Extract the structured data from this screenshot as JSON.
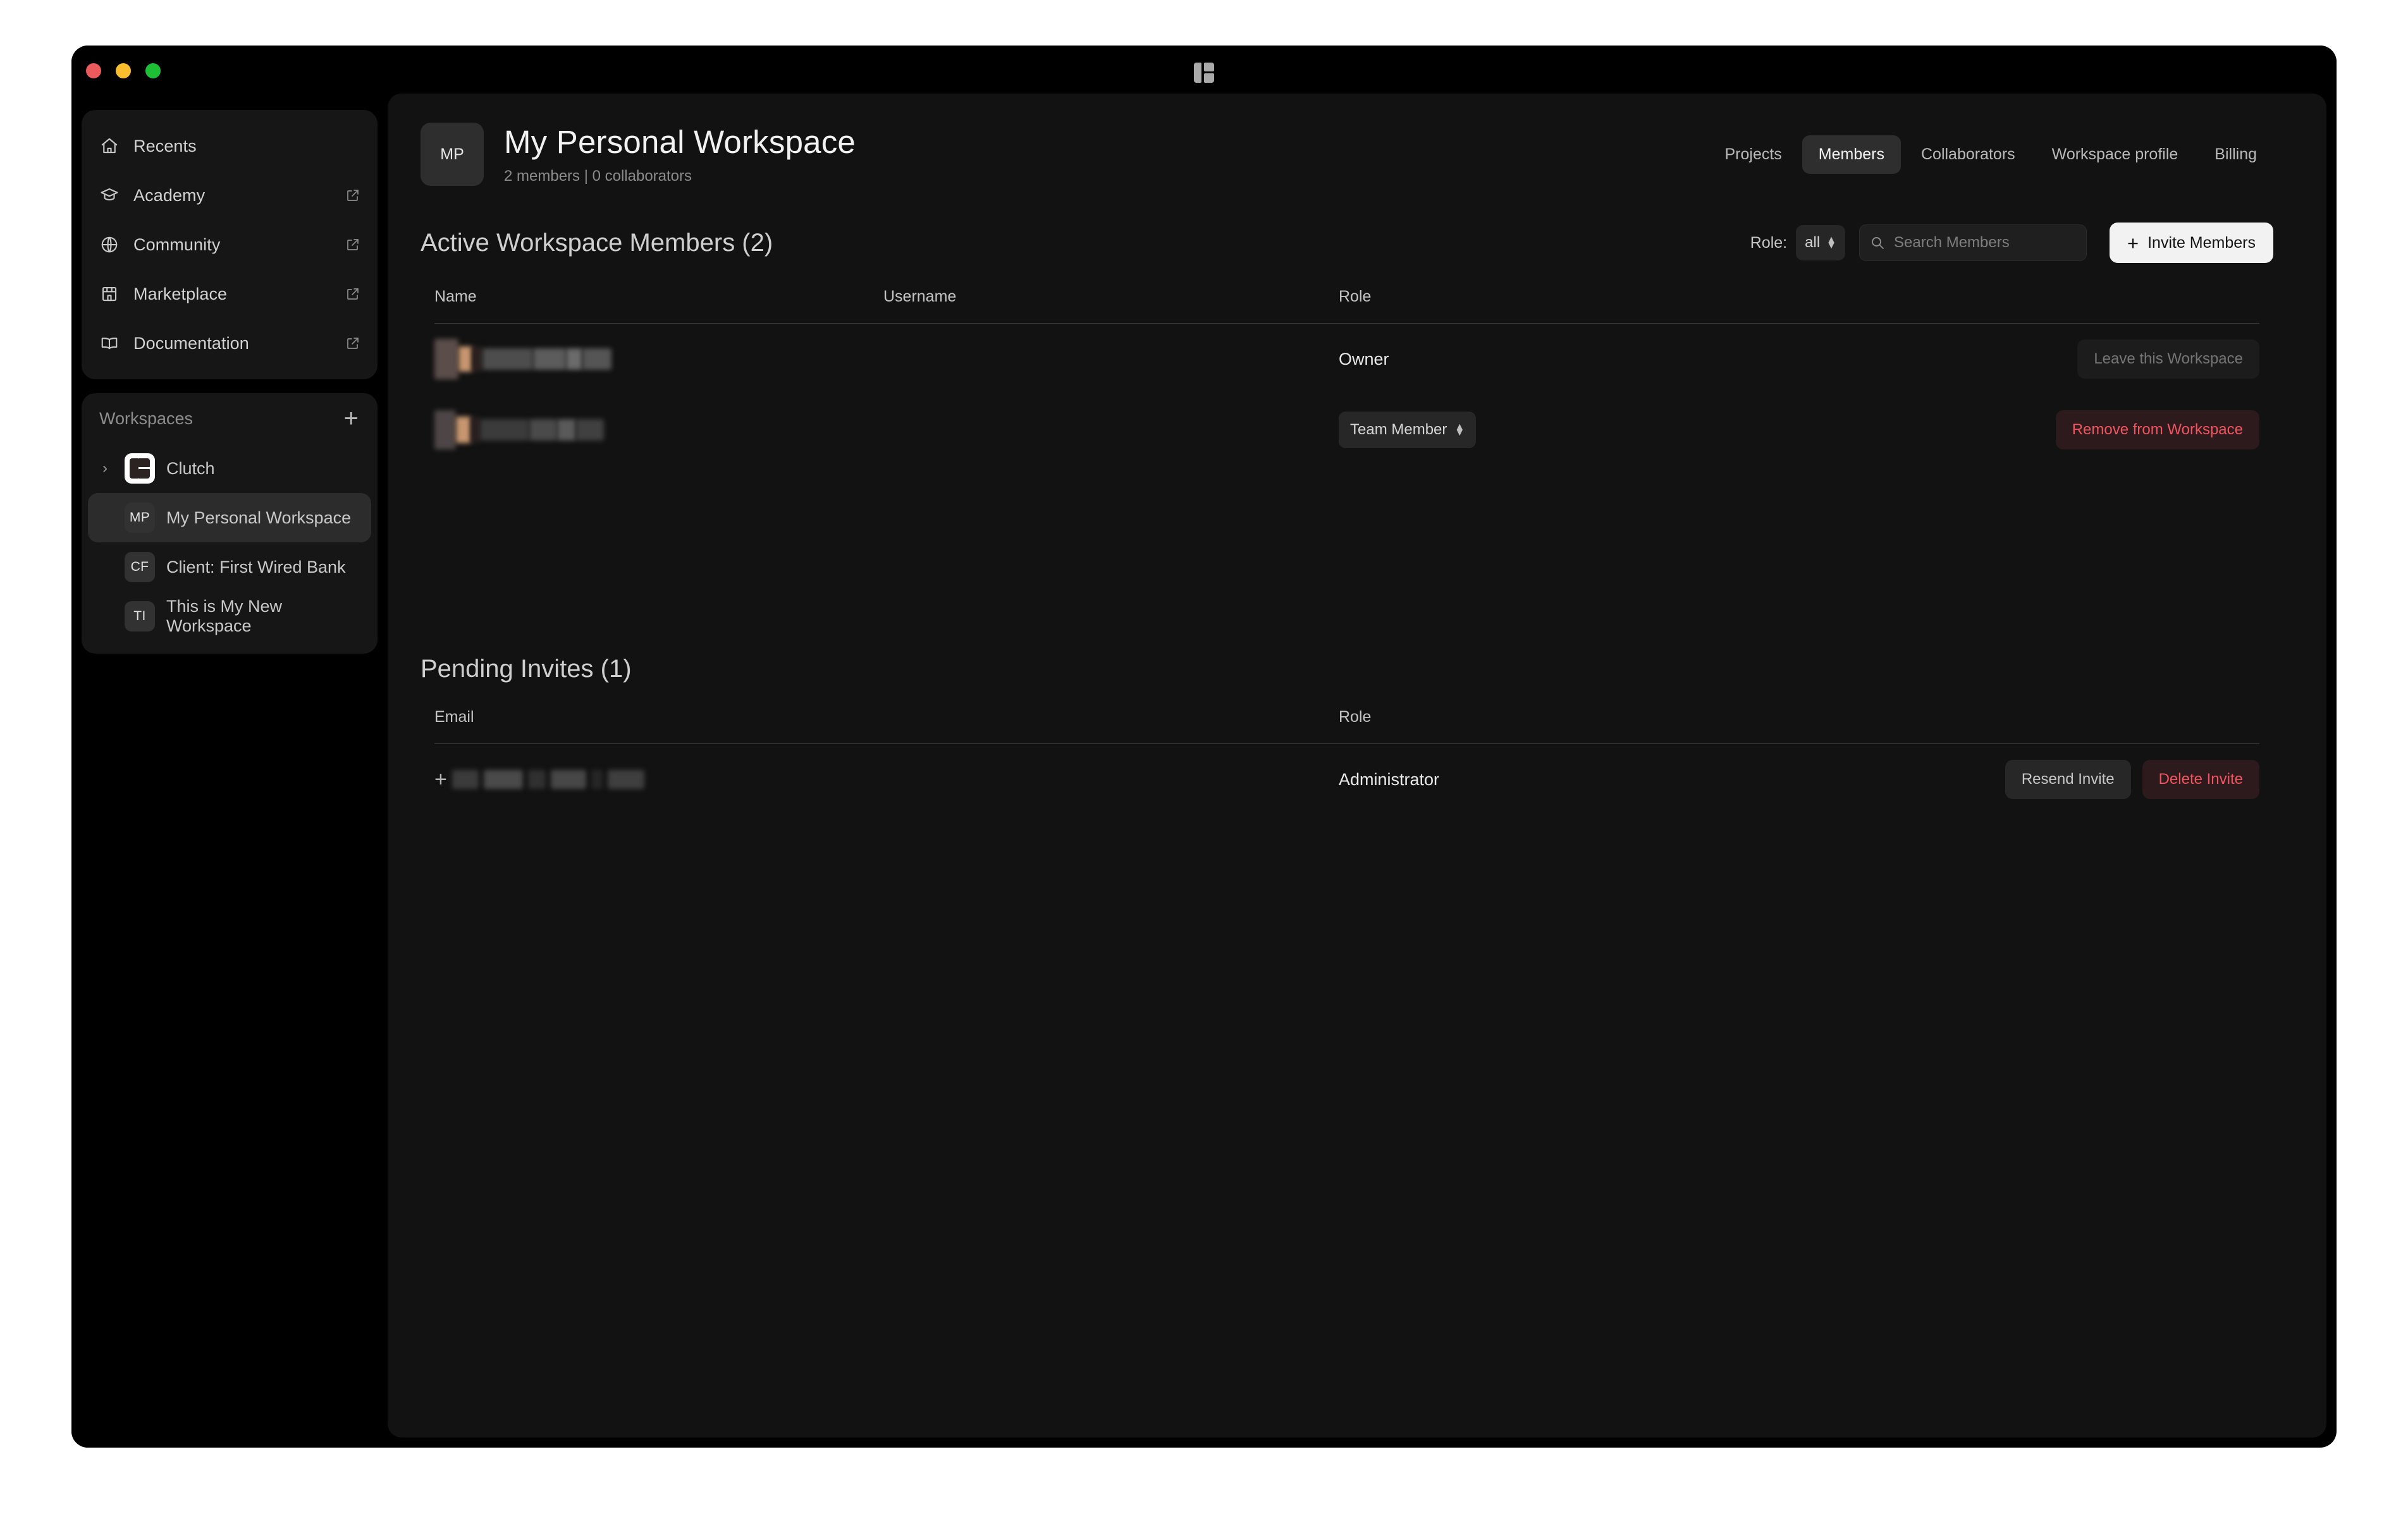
{
  "window": {
    "traffic_lights": [
      "close",
      "minimize",
      "maximize"
    ],
    "logo_name": "clutch-logo-icon"
  },
  "sidebar": {
    "nav": [
      {
        "label": "Recents",
        "icon": "home-icon",
        "external": false
      },
      {
        "label": "Academy",
        "icon": "graduation-cap-icon",
        "external": true
      },
      {
        "label": "Community",
        "icon": "globe-icon",
        "external": true
      },
      {
        "label": "Marketplace",
        "icon": "storefront-icon",
        "external": true
      },
      {
        "label": "Documentation",
        "icon": "book-open-icon",
        "external": true
      }
    ],
    "workspaces_header": {
      "title": "Workspaces",
      "add_label": "+"
    },
    "workspaces": [
      {
        "label": "Clutch",
        "initials": "",
        "selected": false,
        "expandable": true,
        "logo": true
      },
      {
        "label": "My Personal Workspace",
        "initials": "MP",
        "selected": true,
        "expandable": false,
        "logo": false
      },
      {
        "label": "Client: First Wired Bank",
        "initials": "CF",
        "selected": false,
        "expandable": false,
        "logo": false
      },
      {
        "label": "This is My New Workspace",
        "initials": "TI",
        "selected": false,
        "expandable": false,
        "logo": false
      }
    ]
  },
  "header": {
    "avatar_initials": "MP",
    "title": "My Personal Workspace",
    "subtitle": "2 members | 0 collaborators",
    "tabs": [
      {
        "label": "Projects",
        "active": false
      },
      {
        "label": "Members",
        "active": true
      },
      {
        "label": "Collaborators",
        "active": false
      },
      {
        "label": "Workspace profile",
        "active": false
      },
      {
        "label": "Billing",
        "active": false
      }
    ]
  },
  "members_section": {
    "title": "Active Workspace Members (2)",
    "role_filter": {
      "label": "Role:",
      "value": "all"
    },
    "search": {
      "placeholder": "Search Members"
    },
    "invite_button": {
      "plus": "+",
      "label": "Invite Members"
    },
    "columns": [
      "Name",
      "Username",
      "Role"
    ],
    "rows": [
      {
        "name_redacted": true,
        "username": "",
        "role": "Owner",
        "role_is_select": false,
        "action": {
          "label": "Leave this Workspace",
          "style": "ghost-disabled"
        }
      },
      {
        "name_redacted": true,
        "username": "",
        "role": "Team Member",
        "role_is_select": true,
        "action": {
          "label": "Remove from Workspace",
          "style": "danger"
        }
      }
    ]
  },
  "pending_section": {
    "title": "Pending Invites (1)",
    "columns": [
      "Email",
      "Role"
    ],
    "rows": [
      {
        "email_redacted": true,
        "role": "Administrator",
        "actions": [
          {
            "label": "Resend Invite",
            "style": "neutral"
          },
          {
            "label": "Delete Invite",
            "style": "danger"
          }
        ]
      }
    ]
  },
  "colors": {
    "window_bg": "#000000",
    "panel_bg": "#121212",
    "card_bg": "#161616",
    "accent_light": "#f2f2f2",
    "danger": "#f1555f",
    "danger_bg": "#2d1a1d",
    "muted_text": "#8b8b8b"
  }
}
